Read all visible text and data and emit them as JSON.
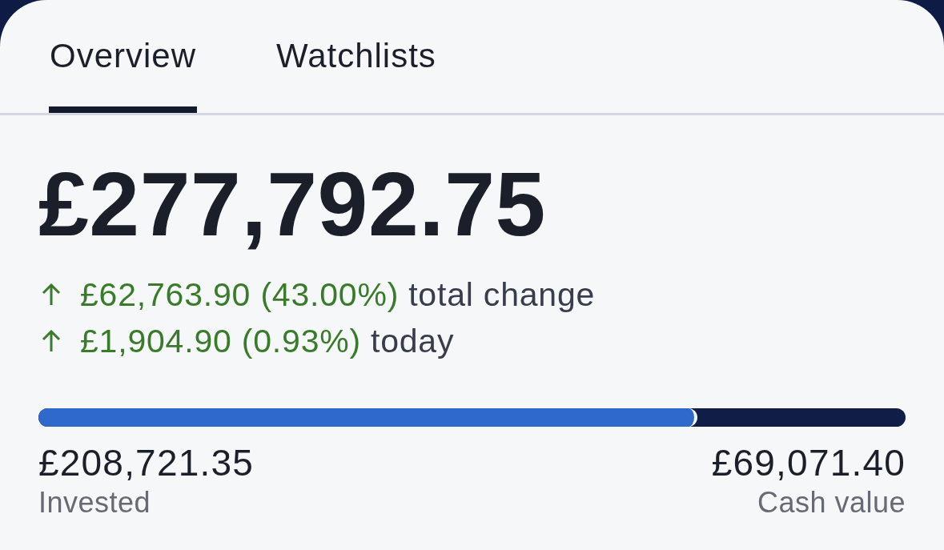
{
  "tabs": [
    {
      "label": "Overview",
      "selected": true
    },
    {
      "label": "Watchlists",
      "selected": false
    }
  ],
  "portfolio": {
    "total_value": "£277,792.75",
    "changes": [
      {
        "positive": true,
        "amount": "£62,763.90 (43.00%)",
        "label": "total change"
      },
      {
        "positive": true,
        "amount": "£1,904.90 (0.93%)",
        "label": "today"
      }
    ],
    "allocation": {
      "level": 0.76,
      "segments": [
        {
          "value": "£208,721.35",
          "label": "Invested"
        },
        {
          "value": "£69,071.40",
          "label": "Cash value"
        }
      ]
    }
  }
}
